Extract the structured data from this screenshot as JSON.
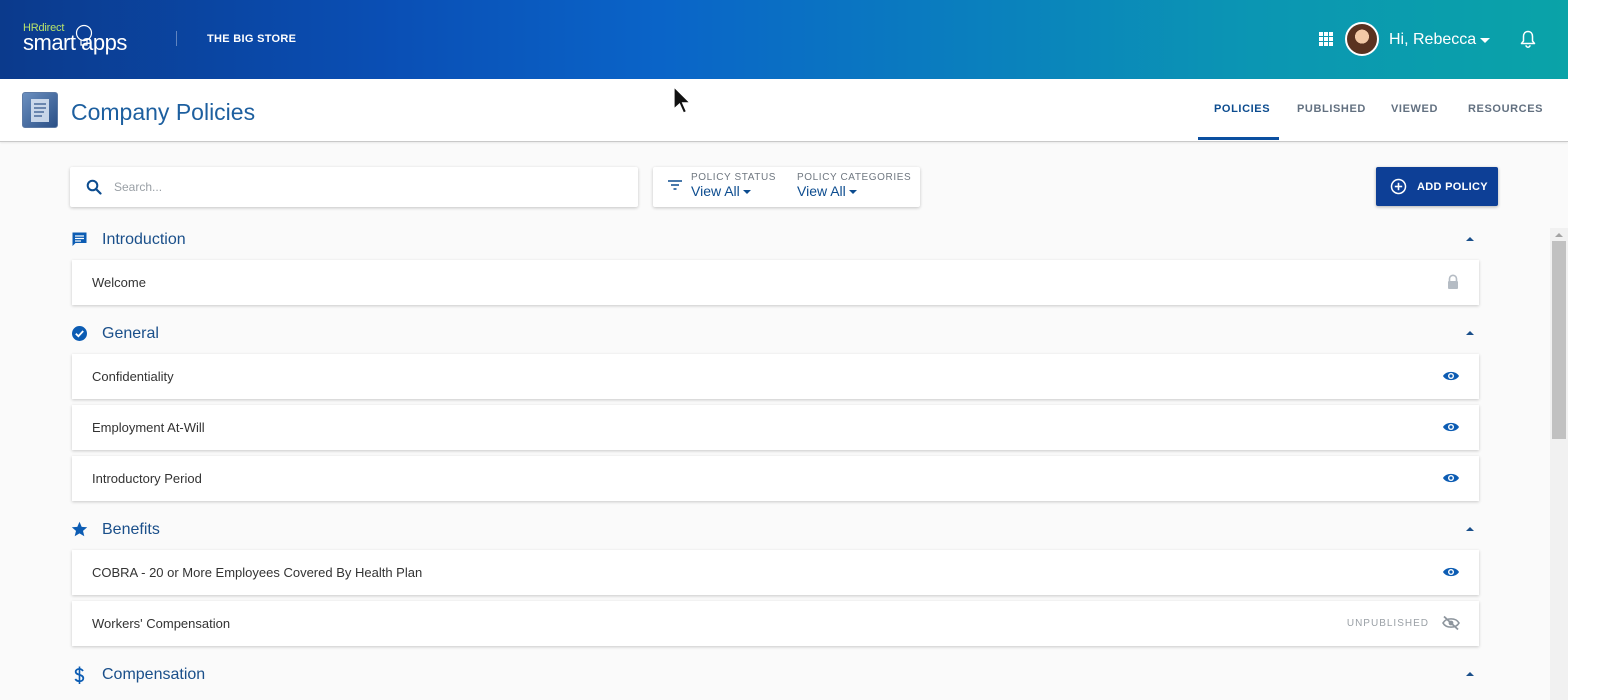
{
  "header": {
    "logo_top": "HRdirect",
    "logo_main": "smart apps",
    "store_name": "THE BIG STORE",
    "greeting": "Hi, Rebecca",
    "colors": {
      "gradient_start": "#0b3a8c",
      "gradient_end": "#0aa3a8"
    }
  },
  "subheader": {
    "title": "Company Policies",
    "tabs": [
      {
        "label": "POLICIES",
        "active": true
      },
      {
        "label": "PUBLISHED",
        "active": false
      },
      {
        "label": "VIEWED",
        "active": false
      },
      {
        "label": "RESOURCES",
        "active": false
      }
    ]
  },
  "toolbar": {
    "search_placeholder": "Search...",
    "search_value": "",
    "policy_status_label": "POLICY STATUS",
    "policy_status_value": "View All",
    "policy_categories_label": "POLICY CATEGORIES",
    "policy_categories_value": "View All",
    "add_policy_label": "ADD POLICY",
    "accent_color": "#0d3f96"
  },
  "sections": [
    {
      "title": "Introduction",
      "icon": "message-icon",
      "policies": [
        {
          "name": "Welcome",
          "status": "",
          "icon": "lock-icon"
        }
      ]
    },
    {
      "title": "General",
      "icon": "check-circle-icon",
      "policies": [
        {
          "name": "Confidentiality",
          "status": "",
          "icon": "eye-icon"
        },
        {
          "name": "Employment At-Will",
          "status": "",
          "icon": "eye-icon"
        },
        {
          "name": "Introductory Period",
          "status": "",
          "icon": "eye-icon"
        }
      ]
    },
    {
      "title": "Benefits",
      "icon": "star-icon",
      "policies": [
        {
          "name": "COBRA - 20 or More Employees Covered By Health Plan",
          "status": "",
          "icon": "eye-icon"
        },
        {
          "name": "Workers' Compensation",
          "status": "UNPUBLISHED",
          "icon": "eye-off-icon"
        }
      ]
    },
    {
      "title": "Compensation",
      "icon": "dollar-icon",
      "policies": []
    }
  ]
}
